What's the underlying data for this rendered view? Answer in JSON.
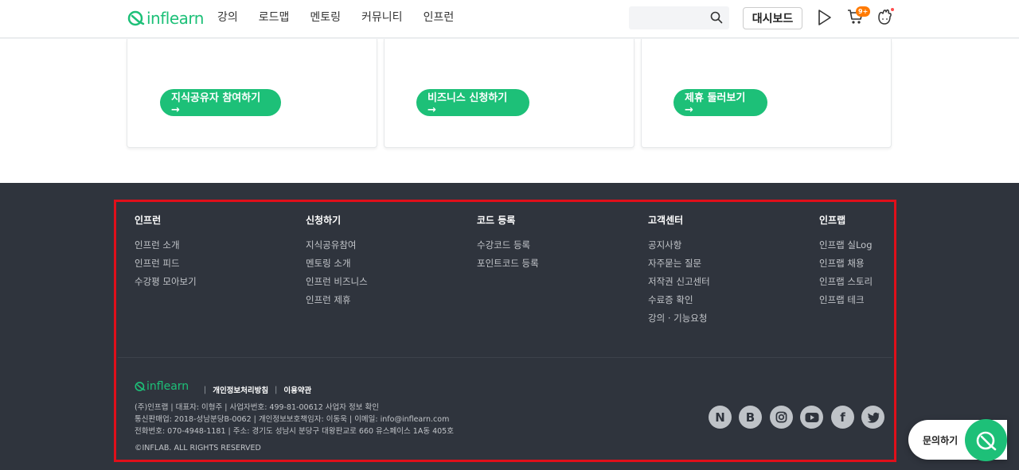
{
  "header": {
    "logo_text": "inflearn",
    "nav": [
      "강의",
      "로드맵",
      "멘토링",
      "커뮤니티",
      "인프런"
    ],
    "search": {
      "placeholder": ""
    },
    "dashboard_label": "대시보드",
    "cart_badge": "9+"
  },
  "cards": [
    {
      "button_label": "지식공유자 참여하기 →"
    },
    {
      "button_label": "비즈니스 신청하기 →"
    },
    {
      "button_label": "제휴 둘러보기 →"
    }
  ],
  "footer": {
    "columns": [
      {
        "title": "인프런",
        "links": [
          "인프런 소개",
          "인프런 피드",
          "수강평 모아보기"
        ]
      },
      {
        "title": "신청하기",
        "links": [
          "지식공유참여",
          "멘토링 소개",
          "인프런 비즈니스",
          "인프런 제휴"
        ]
      },
      {
        "title": "코드 등록",
        "links": [
          "수강코드 등록",
          "포인트코드 등록"
        ]
      },
      {
        "title": "고객센터",
        "links": [
          "공지사항",
          "자주묻는 질문",
          "저작권 신고센터",
          "수료증 확인",
          "강의 · 기능요청"
        ]
      },
      {
        "title": "인프랩",
        "links": [
          "인프랩 실Log",
          "인프랩 채용",
          "인프랩 스토리",
          "인프랩 테크"
        ]
      }
    ],
    "logo_text": "inflearn",
    "policy_links": [
      "개인정보처리방침",
      "이용약관"
    ],
    "info_lines": [
      "(주)인프랩 | 대표자: 이형주 | 사업자번호: 499-81-00612 사업자 정보 확인",
      "통신판매업: 2018-성남분당B-0062 | 개인정보보호책임자: 이동욱 | 이메일: info@inflearn.com",
      "전화번호: 070-4948-1181 | 주소: 경기도 성남시 분당구 대왕판교로 660 유스페이스 1A동 405호"
    ],
    "copyright": "©INFLAB. ALL RIGHTS RESERVED",
    "social": [
      {
        "icon": "naver-icon",
        "glyph": "N"
      },
      {
        "icon": "blog-icon",
        "glyph": "B"
      },
      {
        "icon": "instagram-icon",
        "glyph": ""
      },
      {
        "icon": "youtube-icon",
        "glyph": ""
      },
      {
        "icon": "facebook-icon",
        "glyph": "f"
      },
      {
        "icon": "twitter-icon",
        "glyph": ""
      }
    ]
  },
  "inquiry": {
    "label": "문의하기"
  },
  "colors": {
    "brand": "#1dc078",
    "footer_bg": "#2f343d",
    "highlight_frame": "#e00f1a"
  }
}
